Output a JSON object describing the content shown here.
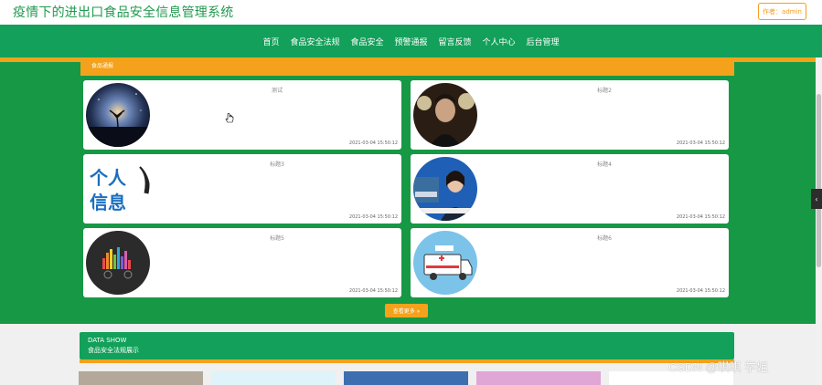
{
  "header": {
    "site_title": "疫情下的进出口食品安全信息管理系统",
    "author_label": "作者：admin"
  },
  "nav": {
    "items": [
      "首页",
      "食品安全法规",
      "食品安全",
      "预警通报",
      "留言反馈",
      "个人中心",
      "后台管理"
    ]
  },
  "section": {
    "header_label": "食品通报"
  },
  "cards": [
    {
      "title": "测试",
      "date": "2021-03-04 15:50:12",
      "thumb": "night-sky-tree"
    },
    {
      "title": "标题2",
      "date": "2021-03-04 15:50:12",
      "thumb": "stage-performer"
    },
    {
      "title": "标题3",
      "date": "2021-03-04 15:50:12",
      "thumb": "personal-info-text"
    },
    {
      "title": "标题4",
      "date": "2021-03-04 15:50:12",
      "thumb": "news-anchor"
    },
    {
      "title": "标题5",
      "date": "2021-03-04 15:50:12",
      "thumb": "music-equalizer"
    },
    {
      "title": "标题6",
      "date": "2021-03-04 15:50:12",
      "thumb": "ambulance"
    }
  ],
  "more_button": {
    "label": "查看更多 »"
  },
  "data_show": {
    "title_en": "DATA SHOW",
    "title_cn": "食品安全法规展示"
  },
  "watermark": "CSDN @琪琪 学姐",
  "side_tab": {
    "icon": "chevron-left-icon",
    "glyph": "‹"
  },
  "colors": {
    "brand_green": "#13a05a",
    "area_green": "#179845",
    "accent_orange": "#f4a21b"
  }
}
